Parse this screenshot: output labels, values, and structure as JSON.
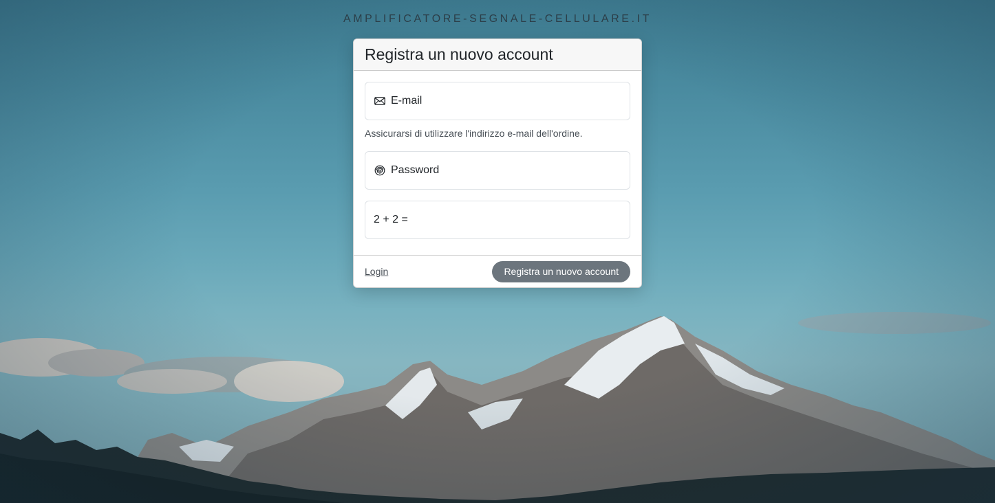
{
  "site": {
    "title": "AMPLIFICATORE-SEGNALE-CELLULARE.IT"
  },
  "form": {
    "title": "Registra un nuovo account",
    "email": {
      "placeholder": "E-mail",
      "value": "",
      "icon": "envelope-icon"
    },
    "email_help": "Assicurarsi di utilizzare l'indirizzo e-mail dell'ordine.",
    "password": {
      "placeholder": "Password",
      "value": "",
      "icon": "fingerprint-icon"
    },
    "captcha": {
      "question": "2 + 2 =",
      "value": ""
    },
    "login_link": "Login",
    "submit_label": "Registra un nuovo account"
  },
  "colors": {
    "button_bg": "#6c757d",
    "header_bg": "#f7f7f7",
    "sky": "#5a9cb0"
  }
}
